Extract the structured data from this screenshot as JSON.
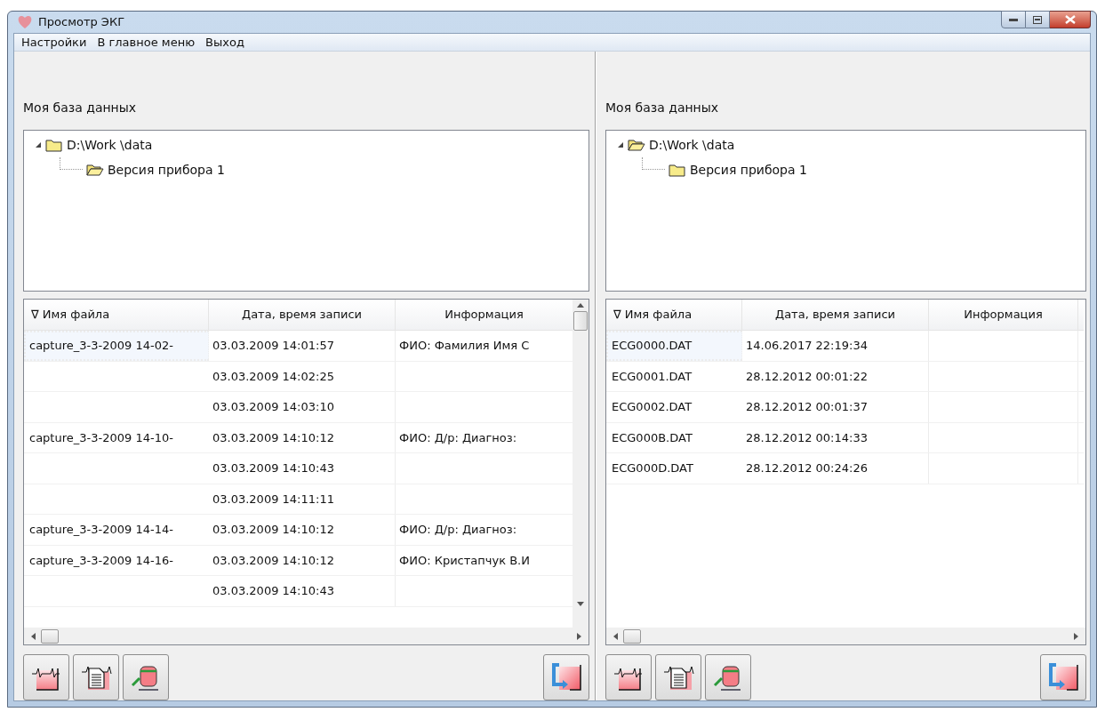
{
  "window": {
    "title": "Просмотр ЭКГ"
  },
  "menu": [
    "Настройки",
    "В главное меню",
    "Выход"
  ],
  "panels": [
    {
      "label": "Моя база данных",
      "tree": [
        {
          "label": "D:\\Work \\data",
          "expanded": true,
          "open": false,
          "children": [
            {
              "label": "Версия прибора 1",
              "open": true
            }
          ]
        }
      ],
      "columns": [
        "∇ Имя файла",
        "Дата, время записи",
        "Информация"
      ],
      "vertical_scrollbar": true,
      "rows": [
        {
          "cells": [
            "capture_3-3-2009 14-02-",
            "03.03.2009 14:01:57",
            "ФИО: Фамилия Имя С"
          ],
          "focused": true
        },
        {
          "cells": [
            "",
            "03.03.2009 14:02:25",
            ""
          ],
          "focused": false
        },
        {
          "cells": [
            "",
            "03.03.2009 14:03:10",
            ""
          ],
          "focused": false
        },
        {
          "cells": [
            "capture_3-3-2009 14-10-",
            "03.03.2009 14:10:12",
            "ФИО: Д/р:  Диагноз:"
          ],
          "focused": false
        },
        {
          "cells": [
            "",
            "03.03.2009 14:10:43",
            ""
          ],
          "focused": false
        },
        {
          "cells": [
            "",
            "03.03.2009 14:11:11",
            ""
          ],
          "focused": false
        },
        {
          "cells": [
            "capture_3-3-2009 14-14-",
            "03.03.2009 14:10:12",
            "ФИО: Д/р:  Диагноз:"
          ],
          "focused": false
        },
        {
          "cells": [
            "capture_3-3-2009 14-16-",
            "03.03.2009 14:10:12",
            "ФИО: Кристапчук В.И"
          ],
          "focused": false
        },
        {
          "cells": [
            "",
            "03.03.2009 14:10:43",
            ""
          ],
          "focused": false
        }
      ]
    },
    {
      "label": "Моя база данных",
      "tree": [
        {
          "label": "D:\\Work \\data",
          "expanded": true,
          "open": true,
          "children": [
            {
              "label": "Версия прибора 1",
              "open": false
            }
          ]
        }
      ],
      "columns": [
        "∇ Имя файла",
        "Дата, время записи",
        "Информация"
      ],
      "vertical_scrollbar": false,
      "rows": [
        {
          "cells": [
            "ECG0000.DAT",
            "14.06.2017 22:19:34",
            ""
          ],
          "focused": true
        },
        {
          "cells": [
            "ECG0001.DAT",
            "28.12.2012 00:01:22",
            ""
          ],
          "focused": false
        },
        {
          "cells": [
            "ECG0002.DAT",
            "28.12.2012 00:01:37",
            ""
          ],
          "focused": false
        },
        {
          "cells": [
            "ECG000B.DAT",
            "28.12.2012 00:14:33",
            ""
          ],
          "focused": false
        },
        {
          "cells": [
            "ECG000D.DAT",
            "28.12.2012 00:24:26",
            ""
          ],
          "focused": false
        }
      ]
    }
  ]
}
